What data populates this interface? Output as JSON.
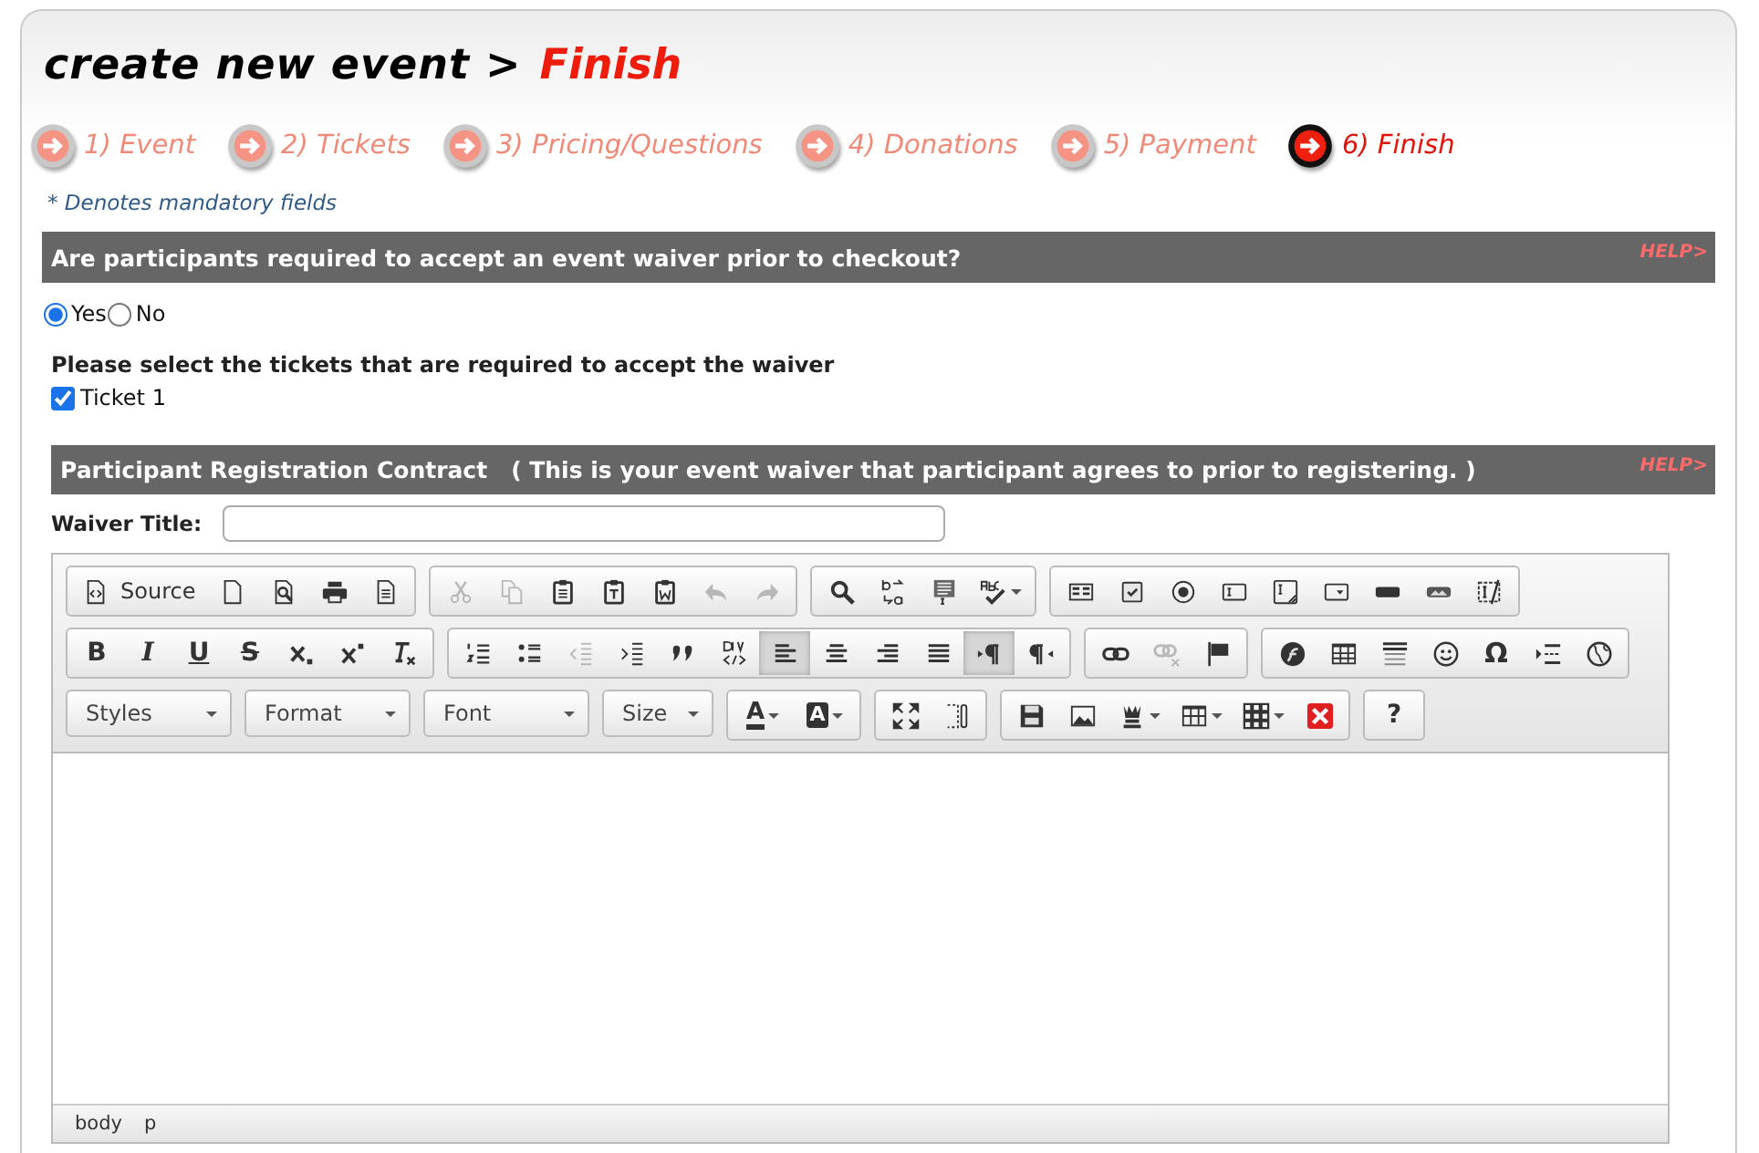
{
  "title": {
    "text": "create new event >",
    "current": "Finish"
  },
  "steps": [
    {
      "label": "1) Event",
      "selected": false
    },
    {
      "label": "2) Tickets",
      "selected": false
    },
    {
      "label": "3) Pricing/Questions",
      "selected": false
    },
    {
      "label": "4) Donations",
      "selected": false
    },
    {
      "label": "5) Payment",
      "selected": false
    },
    {
      "label": "6) Finish",
      "selected": true
    }
  ],
  "note": "* Denotes mandatory fields",
  "waiver_question": {
    "heading": "Are participants required to accept an event waiver prior to checkout?",
    "help": "HELP>",
    "options": [
      {
        "label": "Yes",
        "selected": true
      },
      {
        "label": "No",
        "selected": false
      }
    ]
  },
  "ticket_prompt": "Please select the tickets that are required to accept the waiver",
  "tickets": [
    {
      "label": "Ticket 1",
      "checked": true
    }
  ],
  "contract": {
    "heading": "Participant Registration Contract",
    "note": "( This is your event waiver that participant agrees to prior to registering. )",
    "help": "HELP>",
    "waiver_title_label": "Waiver Title:"
  },
  "editor": {
    "toolbar": [
      [
        [
          {
            "kind": "text_icon",
            "label": "Source",
            "disabled": false,
            "on": false
          },
          {
            "kind": "icon",
            "disabled": false,
            "on": false
          },
          {
            "kind": "icon",
            "disabled": false,
            "on": false
          },
          {
            "kind": "icon",
            "disabled": false,
            "on": false
          },
          {
            "kind": "icon",
            "disabled": false,
            "on": false
          }
        ],
        [
          {
            "kind": "icon",
            "disabled": true,
            "on": false
          },
          {
            "kind": "icon",
            "disabled": true,
            "on": false
          },
          {
            "kind": "icon",
            "disabled": false,
            "on": false
          },
          {
            "kind": "icon",
            "disabled": false,
            "on": false
          },
          {
            "kind": "icon",
            "disabled": false,
            "on": false
          },
          {
            "kind": "icon",
            "disabled": true,
            "on": false
          },
          {
            "kind": "icon",
            "disabled": true,
            "on": false
          }
        ],
        [
          {
            "kind": "icon",
            "disabled": false,
            "on": false
          },
          {
            "kind": "icon",
            "disabled": false,
            "on": false
          },
          {
            "kind": "icon",
            "disabled": false,
            "on": false
          },
          {
            "kind": "icon_menu",
            "disabled": false,
            "on": false
          }
        ],
        [
          {
            "kind": "icon",
            "disabled": false,
            "on": false
          },
          {
            "kind": "icon",
            "disabled": false,
            "on": false
          },
          {
            "kind": "icon",
            "disabled": false,
            "on": false
          },
          {
            "kind": "icon",
            "disabled": false,
            "on": false
          },
          {
            "kind": "icon",
            "disabled": false,
            "on": false
          },
          {
            "kind": "icon",
            "disabled": false,
            "on": false
          },
          {
            "kind": "icon",
            "disabled": false,
            "on": false
          },
          {
            "kind": "icon",
            "disabled": false,
            "on": false
          },
          {
            "kind": "icon",
            "disabled": false,
            "on": false
          }
        ]
      ],
      [
        [
          {
            "kind": "bold",
            "label": "B",
            "disabled": false,
            "on": false
          },
          {
            "kind": "italic",
            "label": "I",
            "disabled": false,
            "on": false
          },
          {
            "kind": "underline",
            "label": "U",
            "disabled": false,
            "on": false
          },
          {
            "kind": "strike",
            "label": "S",
            "disabled": false,
            "on": false
          },
          {
            "kind": "icon",
            "disabled": false,
            "on": false
          },
          {
            "kind": "icon",
            "disabled": false,
            "on": false
          },
          {
            "kind": "icon",
            "disabled": false,
            "on": false
          }
        ],
        [
          {
            "kind": "icon",
            "disabled": false,
            "on": false
          },
          {
            "kind": "icon",
            "disabled": false,
            "on": false
          },
          {
            "kind": "icon",
            "disabled": true,
            "on": false
          },
          {
            "kind": "icon",
            "disabled": false,
            "on": false
          },
          {
            "kind": "icon",
            "disabled": false,
            "on": false
          },
          {
            "kind": "icon",
            "disabled": false,
            "on": false
          },
          {
            "kind": "icon",
            "disabled": false,
            "on": true
          },
          {
            "kind": "icon",
            "disabled": false,
            "on": false
          },
          {
            "kind": "icon",
            "disabled": false,
            "on": false
          },
          {
            "kind": "icon",
            "disabled": false,
            "on": false
          },
          {
            "kind": "icon",
            "disabled": false,
            "on": true
          },
          {
            "kind": "icon",
            "disabled": false,
            "on": false
          }
        ],
        [
          {
            "kind": "icon",
            "disabled": false,
            "on": false
          },
          {
            "kind": "icon",
            "disabled": true,
            "on": false
          },
          {
            "kind": "icon",
            "disabled": false,
            "on": false
          }
        ],
        [
          {
            "kind": "icon",
            "disabled": false,
            "on": false
          },
          {
            "kind": "icon",
            "disabled": false,
            "on": false
          },
          {
            "kind": "icon",
            "disabled": false,
            "on": false
          },
          {
            "kind": "icon",
            "disabled": false,
            "on": false
          },
          {
            "kind": "symbol",
            "label": "Ω",
            "disabled": false,
            "on": false
          },
          {
            "kind": "icon",
            "disabled": false,
            "on": false
          },
          {
            "kind": "icon",
            "disabled": false,
            "on": false
          }
        ]
      ],
      [
        [
          {
            "kind": "combo",
            "label": "Styles"
          }
        ],
        [
          {
            "kind": "combo",
            "label": "Format"
          }
        ],
        [
          {
            "kind": "combo",
            "label": "Font"
          }
        ],
        [
          {
            "kind": "combo",
            "label": "Size"
          }
        ],
        [
          {
            "kind": "text_color",
            "label": "A",
            "disabled": false,
            "on": false
          },
          {
            "kind": "bg_color",
            "label": "A",
            "disabled": false,
            "on": false
          }
        ],
        [
          {
            "kind": "icon",
            "disabled": false,
            "on": false
          },
          {
            "kind": "icon",
            "disabled": false,
            "on": false
          }
        ],
        [
          {
            "kind": "icon",
            "disabled": false,
            "on": false
          },
          {
            "kind": "icon",
            "disabled": false,
            "on": false
          },
          {
            "kind": "icon_menu",
            "disabled": false,
            "on": false
          },
          {
            "kind": "icon_menu",
            "disabled": false,
            "on": false
          },
          {
            "kind": "icon_menu",
            "disabled": false,
            "on": false
          },
          {
            "kind": "icon",
            "disabled": false,
            "on": false
          }
        ],
        [
          {
            "kind": "bold",
            "label": "?",
            "disabled": false,
            "on": false
          }
        ]
      ]
    ],
    "elements_path": [
      "body",
      "p"
    ]
  }
}
